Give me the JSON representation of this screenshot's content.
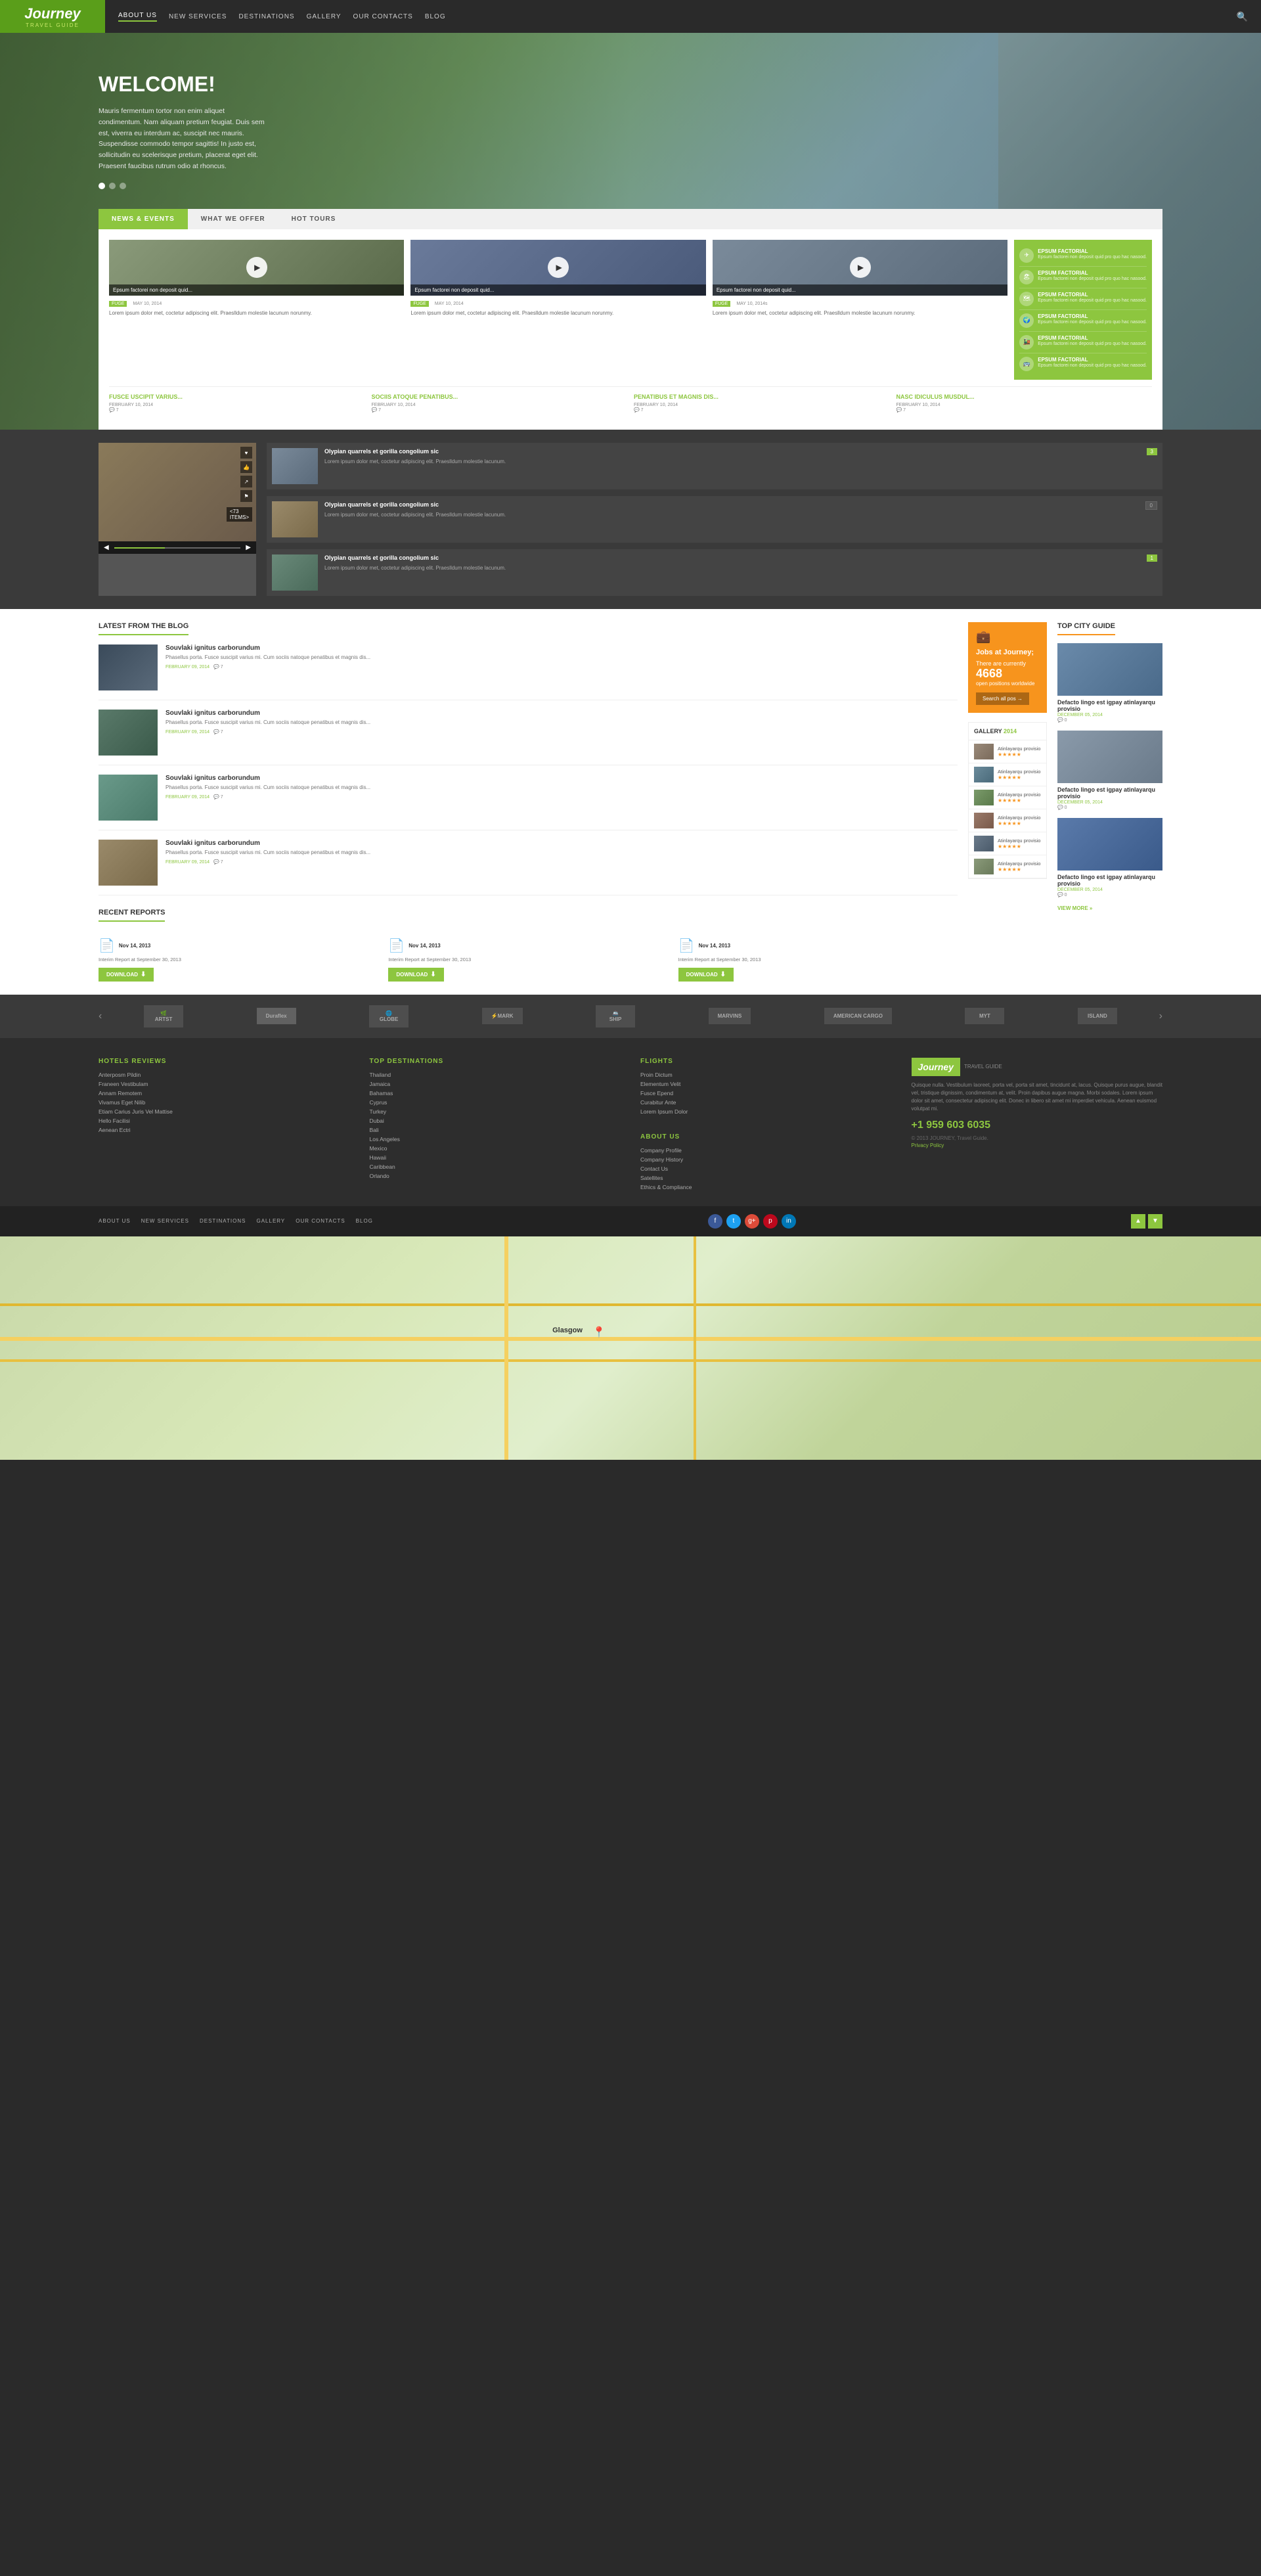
{
  "site": {
    "logo": "Journey",
    "logo_sub": "TRAVEL GUIDE"
  },
  "nav": {
    "items": [
      {
        "label": "ABOUT US",
        "active": true
      },
      {
        "label": "NEW SERVICES",
        "active": false
      },
      {
        "label": "DESTINATIONS",
        "active": false
      },
      {
        "label": "GALLERY",
        "active": false
      },
      {
        "label": "OUR CONTACTS",
        "active": false
      },
      {
        "label": "BLOG",
        "active": false
      }
    ]
  },
  "hero": {
    "title": "WELCOME!",
    "description": "Mauris fermentum tortor non enim aliquet condimentum. Nam aliquam pretium feugiat. Duis sem est, viverra eu interdum ac, suscipit nec mauris. Suspendisse commodo tempor sagittis! In justo est, sollicitudin eu scelerisque pretium, placerat eget elit. Praesent faucibus rutrum odio at rhoncus."
  },
  "tabs": {
    "items": [
      {
        "label": "NEWS & EVENTS",
        "active": true
      },
      {
        "label": "WHAT WE OFFER",
        "active": false
      },
      {
        "label": "HOT TOURS",
        "active": false
      }
    ]
  },
  "video_cards": [
    {
      "tag": "FUGE",
      "date": "MAY 10, 2014",
      "title": "Epsum factorei non deposit quid...",
      "desc": "Lorem ipsum dolor met, coctetur adipiscing elit. Praeslldum molestie lacunum norunmy."
    },
    {
      "tag": "FUGE",
      "date": "MAY 10, 2014",
      "title": "Epsum factorei non deposit quid...",
      "desc": "Lorem ipsum dolor met, coctetur adipiscing elit. Praeslldum molestie lacunum norunmy."
    },
    {
      "tag": "FUGE",
      "date": "MAY 10, 2014s",
      "title": "Epsum factorei non deposit quid...",
      "desc": "Lorem ipsum dolor met, coctetur adipiscing elit. Praeslldum molestie lacunum norunmy."
    }
  ],
  "sidebar_features": [
    {
      "icon": "✈",
      "title": "EPSUM FACTORIAL",
      "desc": "Epsum factorei non deposit quid pro quo hac nasood."
    },
    {
      "icon": "🏖",
      "title": "EPSUM FACTORIAL",
      "desc": "Epsum factorei non deposit quid pro quo hac nasood."
    },
    {
      "icon": "🗺",
      "title": "EPSUM FACTORIAL",
      "desc": "Epsum factorei non deposit quid pro quo hac nasood."
    },
    {
      "icon": "🌍",
      "title": "EPSUM FACTORIAL",
      "desc": "Epsum factorei non deposit quid pro quo hac nasood."
    },
    {
      "icon": "🚂",
      "title": "EPSUM FACTORIAL",
      "desc": "Epsum factorei non deposit quid pro quo hac nasood."
    },
    {
      "icon": "🚌",
      "title": "EPSUM FACTORIAL",
      "desc": "Epsum factorei non deposit quid pro quo hac nasood."
    }
  ],
  "bottom_news": [
    {
      "title": "FUSCE USCIPIT VARIUS...",
      "date": "FEBRUARY 10, 2014",
      "comments": "7"
    },
    {
      "title": "SOCIIS ATOQUE PENATIBUS...",
      "date": "FEBRUARY 10, 2014",
      "comments": "7"
    },
    {
      "title": "PENATIBUS ET MAGNIS DIS...",
      "date": "FEBRUARY 10, 2014",
      "comments": "7"
    },
    {
      "title": "NASC IDICULUS MUSDUL...",
      "date": "FEBRUARY 10, 2014",
      "comments": "7"
    }
  ],
  "featured": {
    "list": [
      {
        "title": "Olypian quarrels et gorilla congolium sic",
        "desc": "Lorem ipsum dolor met, coctetur adipiscing elit. Praeslldum molestie lacunum.",
        "badge": "3"
      },
      {
        "title": "Olypian quarrels et gorilla congolium sic",
        "desc": "Lorem ipsum dolor met, coctetur adipiscing elit. Praeslldum molestie lacunum.",
        "badge": "0"
      },
      {
        "title": "Olypian quarrels et gorilla congolium sic",
        "desc": "Lorem ipsum dolor met, coctetur adipiscing elit. Praeslldum molestie lacunum.",
        "badge": "1"
      }
    ]
  },
  "blog": {
    "section_title": "LATEST FROM THE BLOG",
    "items": [
      {
        "title": "Souvlaki ignitus carborundum",
        "excerpt": "Phasellus porta. Fusce suscipit varius mi. Cum sociis natoque penatibus et magnis dis...",
        "date": "FEBRUARY 09, 2014",
        "comments": "7"
      },
      {
        "title": "Souvlaki ignitus carborundum",
        "excerpt": "Phasellus porta. Fusce suscipit varius mi. Cum sociis natoque penatibus et magnis dis...",
        "date": "FEBRUARY 09, 2014",
        "comments": "7"
      },
      {
        "title": "Souvlaki ignitus carborundum",
        "excerpt": "Phasellus porta. Fusce suscipit varius mi. Cum sociis natoque penatibus et magnis dis...",
        "date": "FEBRUARY 09, 2014",
        "comments": "7"
      },
      {
        "title": "Souvlaki ignitus carborundum",
        "excerpt": "Phasellus porta. Fusce suscipit varius mi. Cum sociis natoque penatibus et magnis dis...",
        "date": "FEBRUARY 09, 2014",
        "comments": "7"
      }
    ]
  },
  "reports": {
    "section_title": "RECENT REPORTS",
    "items": [
      {
        "date": "Nov 14, 2013",
        "desc": "Interim Report at September 30, 2013",
        "download_label": "Download"
      },
      {
        "date": "Nov 14, 2013",
        "desc": "Interim Report at September 30, 2013",
        "download_label": "Download"
      },
      {
        "date": "Nov 14, 2013",
        "desc": "Interim Report at September 30, 2013",
        "download_label": "Download"
      }
    ]
  },
  "jobs": {
    "icon": "💼",
    "title": "Jobs at Journey;",
    "subtitle1": "There are currently",
    "count": "4668",
    "subtitle2": "open positions worldwide",
    "btn_label": "Search all pos →"
  },
  "gallery": {
    "title": "GALLERY",
    "year": "2014",
    "items": [
      {
        "label": "Atinlayarqu provisio",
        "stars": "★★★★★"
      },
      {
        "label": "Atinlayarqu provisio",
        "stars": "★★★★★"
      },
      {
        "label": "Atinlayarqu provisio",
        "stars": "★★★★★"
      },
      {
        "label": "Atinlayarqu provisio",
        "stars": "★★★★★"
      },
      {
        "label": "Atinlayarqu provisio",
        "stars": "★★★★★"
      },
      {
        "label": "Atinlayarqu provisio",
        "stars": "★★★★★"
      }
    ]
  },
  "city_guide": {
    "title": "TOP CITY GUIDE",
    "items": [
      {
        "title": "Defacto lingo est igpay atinlayarqu provisio",
        "date": "DECEMBER 05, 2014",
        "comments": "0"
      },
      {
        "title": "Defacto lingo est igpay atinlayarqu provisio",
        "date": "DECEMBER 05, 2014",
        "comments": "0"
      },
      {
        "title": "Defacto lingo est igpay atinlayarqu provisio",
        "date": "DECEMBER 05, 2014",
        "comments": "0"
      }
    ],
    "view_more": "VIEW MORE »"
  },
  "brands": [
    "ARTST",
    "Duraflex",
    "GLOBE",
    "MARK",
    "SHIP",
    "MARVINS",
    "AMERICAN CARGO",
    "MYT",
    "ISLAND"
  ],
  "footer": {
    "hotels": {
      "title": "HOTELS REVIEWS",
      "links": [
        "Anterposm Pildin",
        "Franeen Vestibulam",
        "Annam Remotem",
        "Vivamus Eget Nilib",
        "Etiam Carius Juris Vel Mattise",
        "Hello Facilisi",
        "Aenean Ectri"
      ]
    },
    "destinations": {
      "title": "TOP DESTINATIONS",
      "links": [
        "Thailand",
        "Jamaica",
        "Bahamas",
        "Cyprus",
        "Turkey",
        "Dubai",
        "Bali",
        "Los Angeles",
        "Mexico",
        "Hawaii",
        "Caribbean",
        "Orlando"
      ]
    },
    "flights": {
      "title": "FLIGHTS",
      "links": [
        "Proin Dictum",
        "Elementum Velit",
        "Fusce Epend",
        "Curabitur Ante",
        "Lorem Ipsum Dolor"
      ]
    },
    "about": {
      "title": "ABOUT US",
      "links": [
        "Company Profile",
        "Company History",
        "Contact Us",
        "Satellites",
        "Ethics & Compliance"
      ]
    },
    "brand": {
      "logo": "Journey",
      "desc": "Quisque nulla. Vestibulum laoreet, porta vel, porta sit amet, tincidunt at, lacus. Quisque purus augue, blandit vel, tristique dignissim, condimentum at, velit. Proin dapibus augue magna. Morbi sodales. Lorem ipsum dolor sit amet, consectetur adipiscing elit. Donec in libero sit amet mi imperdiet vehicula. Aenean euismod volutpat mi.",
      "phone": "+1 959 603 6035",
      "copy": "© 2013 JOURNEY, Travel Guide.",
      "privacy": "Privacy Policy"
    }
  },
  "bottom_bar": {
    "nav": [
      "ABOUT US",
      "NEW SERVICES",
      "DESTINATIONS",
      "GALLERY",
      "OUR CONTACTS",
      "BLOG"
    ]
  },
  "map": {
    "city": "Glasgow"
  }
}
